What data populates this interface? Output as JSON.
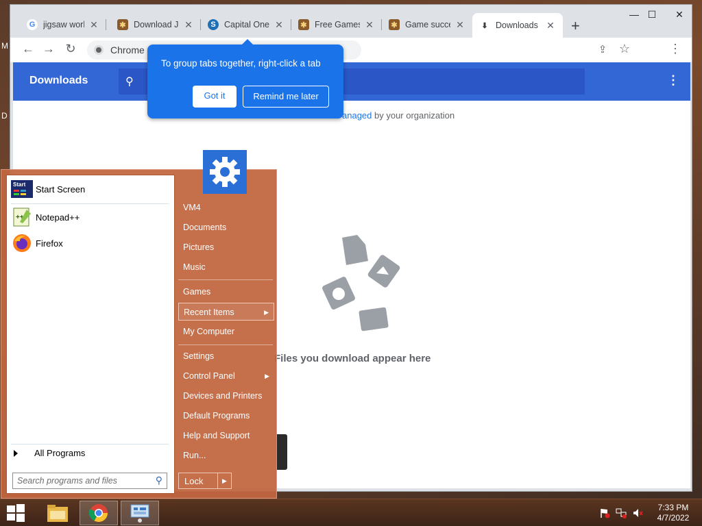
{
  "desktop": {
    "edge_letters": [
      "M",
      "D"
    ]
  },
  "browser": {
    "tabs": [
      {
        "label": "jigsaw world",
        "icon": "google-icon"
      },
      {
        "label": "Download Ji",
        "icon": "jigsaw-game-icon"
      },
      {
        "label": "Capital One",
        "icon": "capital-one-icon"
      },
      {
        "label": "Free Games",
        "icon": "jigsaw-game-icon"
      },
      {
        "label": "Game succe",
        "icon": "jigsaw-game-icon"
      },
      {
        "label": "Downloads",
        "icon": "download-icon"
      }
    ],
    "tab_close": "✕",
    "new_tab": "+",
    "window_controls": {
      "minimize": "—",
      "maximize": "☐",
      "close": "✕"
    },
    "omnibox_text": "Chrome",
    "icons": {
      "back": "←",
      "forward": "→",
      "reload": "↻",
      "share": "⇪",
      "bookmark": "☆",
      "menu": "⋮"
    }
  },
  "downloads_page": {
    "title": "Downloads",
    "search_icon": "⚲",
    "menu_icon": "⋮",
    "managed_prefix": "",
    "managed_link": "anaged",
    "managed_suffix": " by your organization",
    "empty_message": "Files you download appear here"
  },
  "tab_group_bubble": {
    "text": "To group tabs together, right-click a tab",
    "got_it": "Got it",
    "remind_later": "Remind me later"
  },
  "start_menu": {
    "pinned": [
      {
        "label": "Start Screen",
        "icon": "start-screen-icon"
      },
      {
        "label": "Notepad++",
        "icon": "notepad-plus-plus-icon"
      },
      {
        "label": "Firefox",
        "icon": "firefox-icon"
      }
    ],
    "all_programs": "All Programs",
    "search_placeholder": "Search programs and files",
    "right_items": [
      {
        "label": "VM4",
        "submenu": false
      },
      {
        "label": "Documents",
        "submenu": false
      },
      {
        "label": "Pictures",
        "submenu": false
      },
      {
        "label": "Music",
        "submenu": false
      },
      {
        "label": "Games",
        "submenu": false
      },
      {
        "label": "Recent Items",
        "submenu": true
      },
      {
        "label": "My Computer",
        "submenu": false
      },
      {
        "label": "Settings",
        "submenu": false
      },
      {
        "label": "Control Panel",
        "submenu": true
      },
      {
        "label": "Devices and Printers",
        "submenu": false
      },
      {
        "label": "Default Programs",
        "submenu": false
      },
      {
        "label": "Help and Support",
        "submenu": false
      },
      {
        "label": "Run...",
        "submenu": false
      }
    ],
    "start_label_tile": "Start",
    "lock": "Lock",
    "arrow": "▶"
  },
  "taskbar": {
    "apps": [
      "file-explorer-icon",
      "chrome-icon",
      "control-panel-icon"
    ],
    "time": "7:33 PM",
    "date": "4/7/2022"
  },
  "colors": {
    "accent": "#1a73e8",
    "downloads_header": "#3367d6",
    "start_menu": "#c16640"
  }
}
